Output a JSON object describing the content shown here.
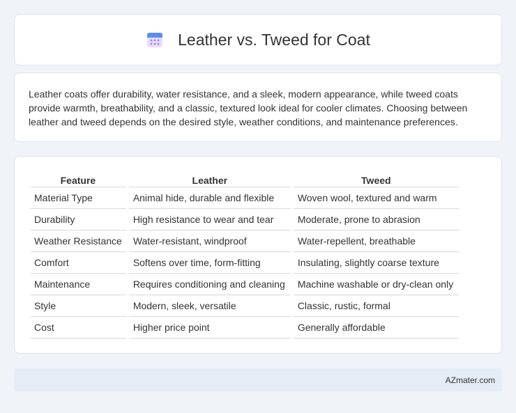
{
  "header": {
    "title": "Leather vs. Tweed for Coat",
    "icon": "calendar-icon",
    "icon_colors": {
      "top": "#5b8def",
      "body": "#e9ddfb",
      "dots": "#a58be8"
    }
  },
  "intro": {
    "text": "Leather coats offer durability, water resistance, and a sleek, modern appearance, while tweed coats provide warmth, breathability, and a classic, textured look ideal for cooler climates. Choosing between leather and tweed depends on the desired style, weather conditions, and maintenance preferences."
  },
  "table": {
    "headers": [
      "Feature",
      "Leather",
      "Tweed"
    ],
    "rows": [
      [
        "Material Type",
        "Animal hide, durable and flexible",
        "Woven wool, textured and warm"
      ],
      [
        "Durability",
        "High resistance to wear and tear",
        "Moderate, prone to abrasion"
      ],
      [
        "Weather Resistance",
        "Water-resistant, windproof",
        "Water-repellent, breathable"
      ],
      [
        "Comfort",
        "Softens over time, form-fitting",
        "Insulating, slightly coarse texture"
      ],
      [
        "Maintenance",
        "Requires conditioning and cleaning",
        "Machine washable or dry-clean only"
      ],
      [
        "Style",
        "Modern, sleek, versatile",
        "Classic, rustic, formal"
      ],
      [
        "Cost",
        "Higher price point",
        "Generally affordable"
      ]
    ]
  },
  "footer": {
    "text": "AZmater.com"
  }
}
